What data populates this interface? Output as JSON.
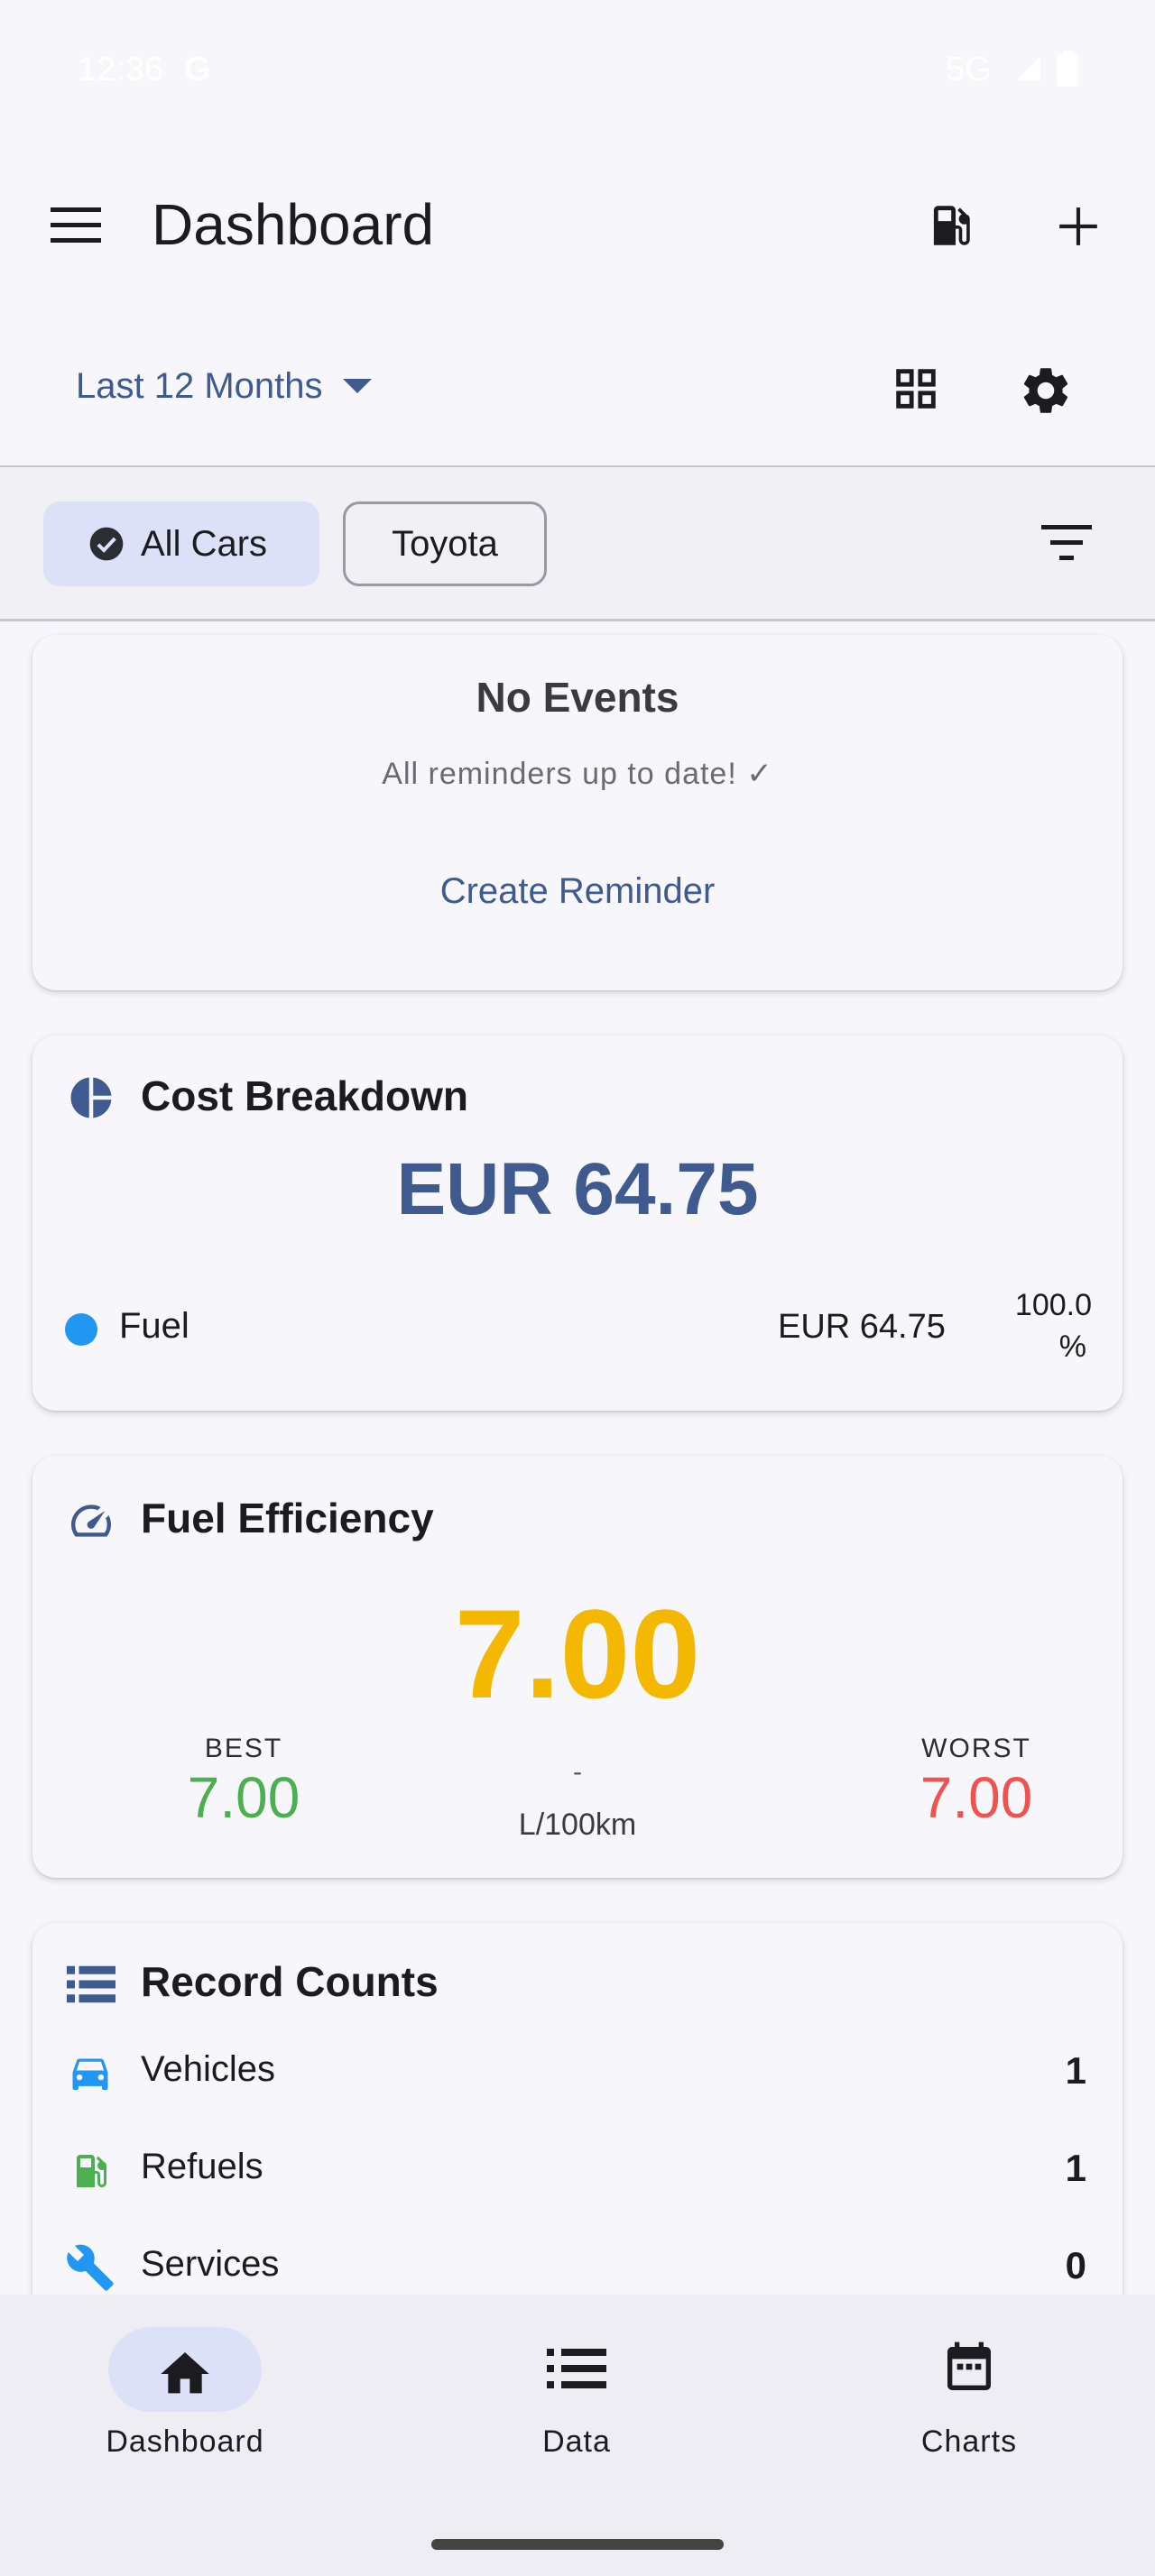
{
  "status_bar": {
    "time": "12:36",
    "carrier_glyph": "G",
    "network": "5G"
  },
  "app_bar": {
    "title": "Dashboard"
  },
  "period_selector": {
    "label": "Last 12 Months"
  },
  "filters": {
    "chips": [
      {
        "label": "All Cars",
        "selected": true
      },
      {
        "label": "Toyota",
        "selected": false
      }
    ]
  },
  "events_card": {
    "title": "No Events",
    "subtitle": "All reminders up to date! ✓",
    "action": "Create Reminder"
  },
  "cost_card": {
    "title": "Cost Breakdown",
    "total": "EUR 64.75",
    "rows": [
      {
        "label": "Fuel",
        "amount": "EUR 64.75",
        "percent_line1": "100.0",
        "percent_line2": "%"
      }
    ],
    "accent_color": "#3f5a8e",
    "fuel_color": "#2196f3"
  },
  "efficiency_card": {
    "title": "Fuel Efficiency",
    "average": "7.00",
    "best_label": "BEST",
    "best_value": "7.00",
    "worst_label": "WORST",
    "worst_value": "7.00",
    "middle_dash": "-",
    "unit": "L/100km",
    "average_color": "#f5b800",
    "best_color": "#4caf50",
    "worst_color": "#ef5350"
  },
  "record_card": {
    "title": "Record Counts",
    "rows": [
      {
        "label": "Vehicles",
        "count": "1",
        "icon": "car-icon"
      },
      {
        "label": "Refuels",
        "count": "1",
        "icon": "fuel-pump-icon"
      },
      {
        "label": "Services",
        "count": "0",
        "icon": "wrench-icon"
      }
    ]
  },
  "bottom_nav": {
    "items": [
      {
        "label": "Dashboard",
        "icon": "home-icon",
        "active": true
      },
      {
        "label": "Data",
        "icon": "list-icon",
        "active": false
      },
      {
        "label": "Charts",
        "icon": "calendar-icon",
        "active": false
      }
    ]
  }
}
